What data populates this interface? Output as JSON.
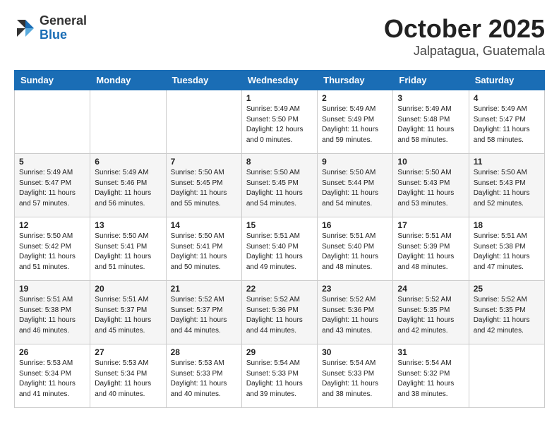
{
  "header": {
    "logo_general": "General",
    "logo_blue": "Blue",
    "title": "October 2025",
    "subtitle": "Jalpatagua, Guatemala"
  },
  "weekdays": [
    "Sunday",
    "Monday",
    "Tuesday",
    "Wednesday",
    "Thursday",
    "Friday",
    "Saturday"
  ],
  "weeks": [
    [
      {
        "day": "",
        "info": ""
      },
      {
        "day": "",
        "info": ""
      },
      {
        "day": "",
        "info": ""
      },
      {
        "day": "1",
        "info": "Sunrise: 5:49 AM\nSunset: 5:50 PM\nDaylight: 12 hours\nand 0 minutes."
      },
      {
        "day": "2",
        "info": "Sunrise: 5:49 AM\nSunset: 5:49 PM\nDaylight: 11 hours\nand 59 minutes."
      },
      {
        "day": "3",
        "info": "Sunrise: 5:49 AM\nSunset: 5:48 PM\nDaylight: 11 hours\nand 58 minutes."
      },
      {
        "day": "4",
        "info": "Sunrise: 5:49 AM\nSunset: 5:47 PM\nDaylight: 11 hours\nand 58 minutes."
      }
    ],
    [
      {
        "day": "5",
        "info": "Sunrise: 5:49 AM\nSunset: 5:47 PM\nDaylight: 11 hours\nand 57 minutes."
      },
      {
        "day": "6",
        "info": "Sunrise: 5:49 AM\nSunset: 5:46 PM\nDaylight: 11 hours\nand 56 minutes."
      },
      {
        "day": "7",
        "info": "Sunrise: 5:50 AM\nSunset: 5:45 PM\nDaylight: 11 hours\nand 55 minutes."
      },
      {
        "day": "8",
        "info": "Sunrise: 5:50 AM\nSunset: 5:45 PM\nDaylight: 11 hours\nand 54 minutes."
      },
      {
        "day": "9",
        "info": "Sunrise: 5:50 AM\nSunset: 5:44 PM\nDaylight: 11 hours\nand 54 minutes."
      },
      {
        "day": "10",
        "info": "Sunrise: 5:50 AM\nSunset: 5:43 PM\nDaylight: 11 hours\nand 53 minutes."
      },
      {
        "day": "11",
        "info": "Sunrise: 5:50 AM\nSunset: 5:43 PM\nDaylight: 11 hours\nand 52 minutes."
      }
    ],
    [
      {
        "day": "12",
        "info": "Sunrise: 5:50 AM\nSunset: 5:42 PM\nDaylight: 11 hours\nand 51 minutes."
      },
      {
        "day": "13",
        "info": "Sunrise: 5:50 AM\nSunset: 5:41 PM\nDaylight: 11 hours\nand 51 minutes."
      },
      {
        "day": "14",
        "info": "Sunrise: 5:50 AM\nSunset: 5:41 PM\nDaylight: 11 hours\nand 50 minutes."
      },
      {
        "day": "15",
        "info": "Sunrise: 5:51 AM\nSunset: 5:40 PM\nDaylight: 11 hours\nand 49 minutes."
      },
      {
        "day": "16",
        "info": "Sunrise: 5:51 AM\nSunset: 5:40 PM\nDaylight: 11 hours\nand 48 minutes."
      },
      {
        "day": "17",
        "info": "Sunrise: 5:51 AM\nSunset: 5:39 PM\nDaylight: 11 hours\nand 48 minutes."
      },
      {
        "day": "18",
        "info": "Sunrise: 5:51 AM\nSunset: 5:38 PM\nDaylight: 11 hours\nand 47 minutes."
      }
    ],
    [
      {
        "day": "19",
        "info": "Sunrise: 5:51 AM\nSunset: 5:38 PM\nDaylight: 11 hours\nand 46 minutes."
      },
      {
        "day": "20",
        "info": "Sunrise: 5:51 AM\nSunset: 5:37 PM\nDaylight: 11 hours\nand 45 minutes."
      },
      {
        "day": "21",
        "info": "Sunrise: 5:52 AM\nSunset: 5:37 PM\nDaylight: 11 hours\nand 44 minutes."
      },
      {
        "day": "22",
        "info": "Sunrise: 5:52 AM\nSunset: 5:36 PM\nDaylight: 11 hours\nand 44 minutes."
      },
      {
        "day": "23",
        "info": "Sunrise: 5:52 AM\nSunset: 5:36 PM\nDaylight: 11 hours\nand 43 minutes."
      },
      {
        "day": "24",
        "info": "Sunrise: 5:52 AM\nSunset: 5:35 PM\nDaylight: 11 hours\nand 42 minutes."
      },
      {
        "day": "25",
        "info": "Sunrise: 5:52 AM\nSunset: 5:35 PM\nDaylight: 11 hours\nand 42 minutes."
      }
    ],
    [
      {
        "day": "26",
        "info": "Sunrise: 5:53 AM\nSunset: 5:34 PM\nDaylight: 11 hours\nand 41 minutes."
      },
      {
        "day": "27",
        "info": "Sunrise: 5:53 AM\nSunset: 5:34 PM\nDaylight: 11 hours\nand 40 minutes."
      },
      {
        "day": "28",
        "info": "Sunrise: 5:53 AM\nSunset: 5:33 PM\nDaylight: 11 hours\nand 40 minutes."
      },
      {
        "day": "29",
        "info": "Sunrise: 5:54 AM\nSunset: 5:33 PM\nDaylight: 11 hours\nand 39 minutes."
      },
      {
        "day": "30",
        "info": "Sunrise: 5:54 AM\nSunset: 5:33 PM\nDaylight: 11 hours\nand 38 minutes."
      },
      {
        "day": "31",
        "info": "Sunrise: 5:54 AM\nSunset: 5:32 PM\nDaylight: 11 hours\nand 38 minutes."
      },
      {
        "day": "",
        "info": ""
      }
    ]
  ]
}
